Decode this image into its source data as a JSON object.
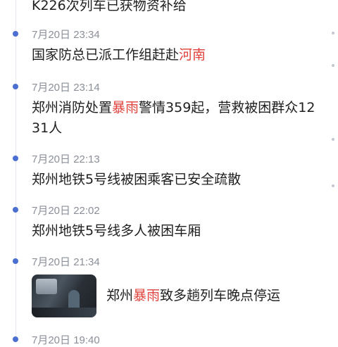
{
  "feed": {
    "top_partial": "K226次列车已获物资补给",
    "items": [
      {
        "time": "7月20日 23:34",
        "text_before": "国家防总已派工作组赶赴",
        "highlight": "河南",
        "text_after": ""
      },
      {
        "time": "7月20日 23:14",
        "text_before": "郑州消防处置",
        "highlight": "暴雨",
        "text_after": "警情359起，营救被困群众1231人"
      },
      {
        "time": "7月20日 22:13",
        "text_before": "郑州地铁5号线被困乘客已安全疏散",
        "highlight": "",
        "text_after": ""
      },
      {
        "time": "7月20日 22:02",
        "text_before": "郑州地铁5号线多人被困车厢",
        "highlight": "",
        "text_after": ""
      },
      {
        "time": "7月20日 21:34",
        "text_before": "郑州",
        "highlight": "暴雨",
        "text_after": "致多趟列车晚点停运",
        "has_thumbnail": true
      }
    ],
    "bottom_partial_time": "7月20日 19:40"
  },
  "colors": {
    "accent_dot": "#4a6fd1",
    "highlight": "#e0413a",
    "time_text": "#8a8f98",
    "body_text": "#1f1f1f"
  }
}
